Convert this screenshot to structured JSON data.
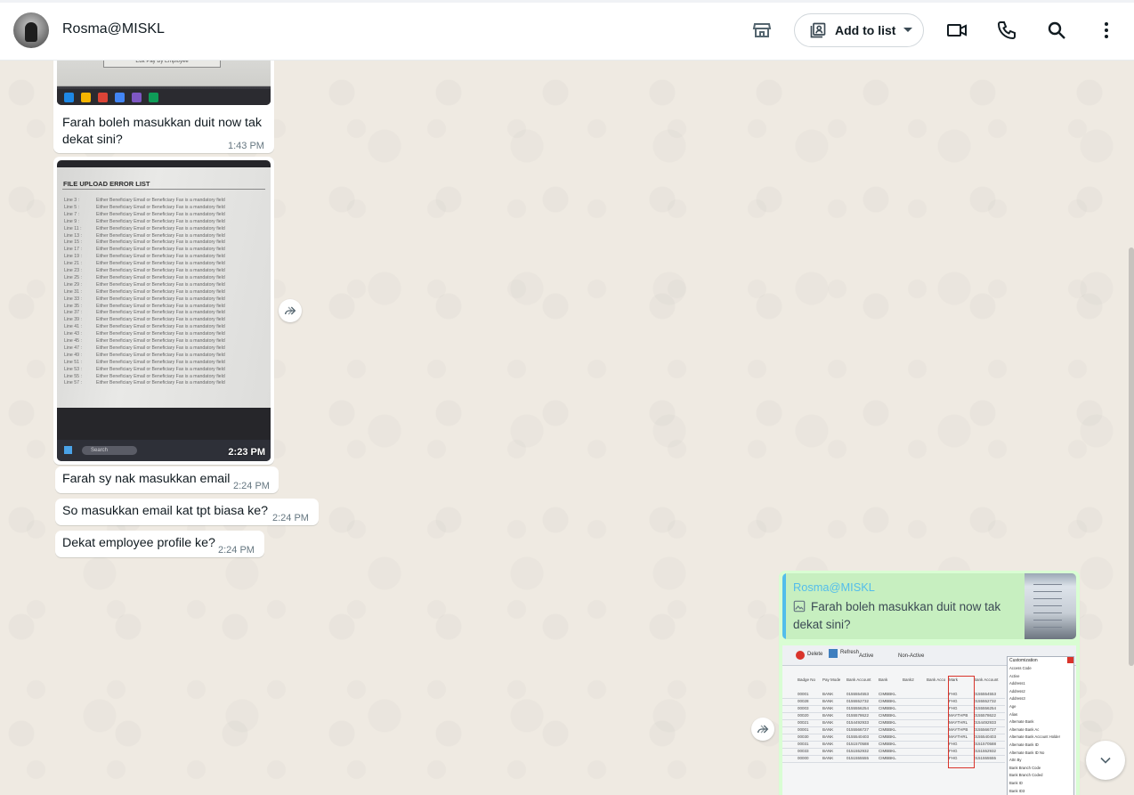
{
  "header": {
    "contact_name": "Rosma@MISKL",
    "add_to_list_label": "Add to list",
    "icons": [
      "catalog-icon",
      "video-call-icon",
      "voice-call-icon",
      "search-icon",
      "menu-icon"
    ]
  },
  "messages": [
    {
      "direction": "incoming",
      "image_caption_text": "Edit Pay By Employee",
      "text": "Farah boleh masukkan duit now tak dekat sini?",
      "time": "1:43 PM"
    },
    {
      "direction": "incoming",
      "image": {
        "title": "FILE UPLOAD ERROR LIST",
        "rows": [
          {
            "line": "Line 3 :",
            "msg": "Either Beneficiary Email or Beneficiary Fax is a mandatory field"
          },
          {
            "line": "Line 5 :",
            "msg": "Either Beneficiary Email or Beneficiary Fax is a mandatory field"
          },
          {
            "line": "Line 7 :",
            "msg": "Either Beneficiary Email or Beneficiary Fax is a mandatory field"
          },
          {
            "line": "Line 9 :",
            "msg": "Either Beneficiary Email or Beneficiary Fax is a mandatory field"
          },
          {
            "line": "Line 11 :",
            "msg": "Either Beneficiary Email or Beneficiary Fax is a mandatory field"
          },
          {
            "line": "Line 13 :",
            "msg": "Either Beneficiary Email or Beneficiary Fax is a mandatory field"
          },
          {
            "line": "Line 15 :",
            "msg": "Either Beneficiary Email or Beneficiary Fax is a mandatory field"
          },
          {
            "line": "Line 17 :",
            "msg": "Either Beneficiary Email or Beneficiary Fax is a mandatory field"
          },
          {
            "line": "Line 19 :",
            "msg": "Either Beneficiary Email or Beneficiary Fax is a mandatory field"
          },
          {
            "line": "Line 21 :",
            "msg": "Either Beneficiary Email or Beneficiary Fax is a mandatory field"
          },
          {
            "line": "Line 23 :",
            "msg": "Either Beneficiary Email or Beneficiary Fax is a mandatory field"
          },
          {
            "line": "Line 25 :",
            "msg": "Either Beneficiary Email or Beneficiary Fax is a mandatory field"
          },
          {
            "line": "Line 29 :",
            "msg": "Either Beneficiary Email or Beneficiary Fax is a mandatory field"
          },
          {
            "line": "Line 31 :",
            "msg": "Either Beneficiary Email or Beneficiary Fax is a mandatory field"
          },
          {
            "line": "Line 33 :",
            "msg": "Either Beneficiary Email or Beneficiary Fax is a mandatory field"
          },
          {
            "line": "Line 35 :",
            "msg": "Either Beneficiary Email or Beneficiary Fax is a mandatory field"
          },
          {
            "line": "Line 37 :",
            "msg": "Either Beneficiary Email or Beneficiary Fax is a mandatory field"
          },
          {
            "line": "Line 39 :",
            "msg": "Either Beneficiary Email or Beneficiary Fax is a mandatory field"
          },
          {
            "line": "Line 41 :",
            "msg": "Either Beneficiary Email or Beneficiary Fax is a mandatory field"
          },
          {
            "line": "Line 43 :",
            "msg": "Either Beneficiary Email or Beneficiary Fax is a mandatory field"
          },
          {
            "line": "Line 45 :",
            "msg": "Either Beneficiary Email or Beneficiary Fax is a mandatory field"
          },
          {
            "line": "Line 47 :",
            "msg": "Either Beneficiary Email or Beneficiary Fax is a mandatory field"
          },
          {
            "line": "Line 49 :",
            "msg": "Either Beneficiary Email or Beneficiary Fax is a mandatory field"
          },
          {
            "line": "Line 51 :",
            "msg": "Either Beneficiary Email or Beneficiary Fax is a mandatory field"
          },
          {
            "line": "Line 53 :",
            "msg": "Either Beneficiary Email or Beneficiary Fax is a mandatory field"
          },
          {
            "line": "Line 55 :",
            "msg": "Either Beneficiary Email or Beneficiary Fax is a mandatory field"
          },
          {
            "line": "Line 57 :",
            "msg": "Either Beneficiary Email or Beneficiary Fax is a mandatory field"
          }
        ],
        "taskbar_search": "Search"
      },
      "time": "2:23 PM"
    },
    {
      "direction": "incoming",
      "text": "Farah sy nak masukkan email",
      "time": "2:24 PM"
    },
    {
      "direction": "incoming",
      "text": "So masukkan email kat tpt biasa ke?",
      "time": "2:24 PM"
    },
    {
      "direction": "incoming",
      "text": "Dekat employee profile ke?",
      "time": "2:24 PM"
    },
    {
      "direction": "outgoing",
      "quote": {
        "author": "Rosma@MISKL",
        "text": "Farah boleh masukkan duit now tak dekat sini?"
      },
      "image": {
        "toolbar": {
          "delete": "Delete",
          "refresh": "Refresh",
          "active": "Active",
          "non_active": "Non-Active"
        },
        "columns": [
          "Badge No",
          "Pay Mode",
          "Bank Account",
          "Bank",
          "Bank2",
          "Bank Acco",
          "Mark",
          "Bank Account"
        ],
        "rows": [
          [
            "00001",
            "BANK",
            "0155554553",
            "CIMBBKL",
            "",
            "",
            "FHG",
            "0155554553"
          ],
          [
            "00028",
            "BANK",
            "0155552732",
            "CIMBBKL",
            "",
            "",
            "FHG",
            "0155552732"
          ],
          [
            "00003",
            "BANK",
            "0155556254",
            "CIMBBKL",
            "",
            "",
            "FHG",
            "0155556254"
          ],
          [
            "00020",
            "BANK",
            "0155578622",
            "CIMBBKL",
            "",
            "",
            "MAYTHPB",
            "0155578622"
          ],
          [
            "00021",
            "BANK",
            "0154492933",
            "CIMBBKL",
            "",
            "",
            "MAYTHRL",
            "0154492933"
          ],
          [
            "00001",
            "BANK",
            "0155566727",
            "CIMBBKL",
            "",
            "",
            "MAYTHPB",
            "0155566727"
          ],
          [
            "00030",
            "BANK",
            "0155540403",
            "CIMBBKL",
            "",
            "",
            "MAYTHRL",
            "0155540403"
          ],
          [
            "00031",
            "BANK",
            "0151570588",
            "CIMBBKL",
            "",
            "",
            "FHG",
            "0151570588"
          ],
          [
            "00033",
            "BANK",
            "0151552932",
            "CIMBBKL",
            "",
            "",
            "FHG",
            "0151552932"
          ],
          [
            "00000",
            "BANK",
            "0151555555",
            "CIMBBKL",
            "",
            "",
            "FHG",
            "0151555555"
          ]
        ],
        "panel": {
          "title": "Customization",
          "items": [
            "Access Code",
            "Active",
            "Address1",
            "Address2",
            "Address3",
            "Age",
            "Alias",
            "Alternate Bank",
            "Alternate Bank Ac",
            "Alternate Bank Account Holder",
            "Alternate Bank ID",
            "Alternate Bank ID No",
            "Attn By",
            "Bank Branch Code",
            "Bank Branch Coded",
            "Bank ID",
            "Bank ID3"
          ]
        }
      }
    }
  ]
}
